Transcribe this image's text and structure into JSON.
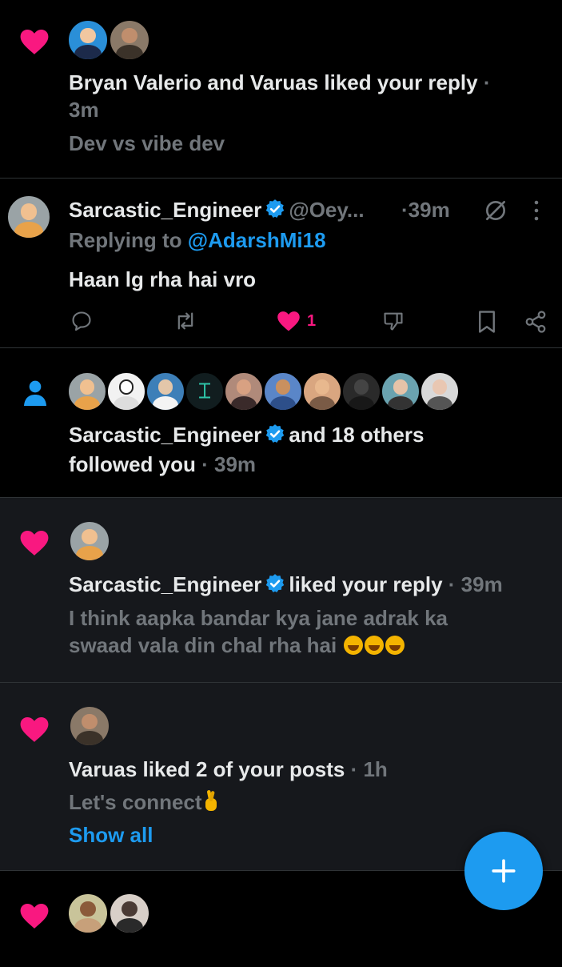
{
  "colors": {
    "like": "#f91880",
    "accent": "#1d9bf0",
    "muted": "#71767b",
    "text": "#e7e9ea"
  },
  "notifications": [
    {
      "type": "like",
      "icon": "heart-icon",
      "names": "Bryan Valerio and Varuas",
      "action": "liked your reply",
      "time_prefix": "·",
      "time": "3m",
      "snippet": "Dev vs vibe dev"
    },
    {
      "type": "reply",
      "author": "Sarcastic_Engineer",
      "handle": "@Oey...",
      "time": "·39m",
      "replying_label": "Replying to",
      "replying_handle": "@AdarshMi18",
      "text": "Haan lg rha hai vro",
      "like_count": "1"
    },
    {
      "type": "follow",
      "icon": "person-icon",
      "author": "Sarcastic_Engineer",
      "rest": "and 18 others",
      "action": "followed you",
      "time": "· 39m"
    },
    {
      "type": "like",
      "icon": "heart-icon",
      "author": "Sarcastic_Engineer",
      "action": "liked your reply",
      "time": "· 39m",
      "line1": "I think aapka bandar kya jane adrak ka",
      "line2": "swaad vala din chal rha hai"
    },
    {
      "type": "like",
      "icon": "heart-icon",
      "names": "Varuas liked 2 of your posts",
      "time": "· 1h",
      "snippet": "Let's connect",
      "show_all": "Show all"
    },
    {
      "type": "like",
      "icon": "heart-icon"
    }
  ],
  "fab": {
    "icon": "plus-icon"
  }
}
